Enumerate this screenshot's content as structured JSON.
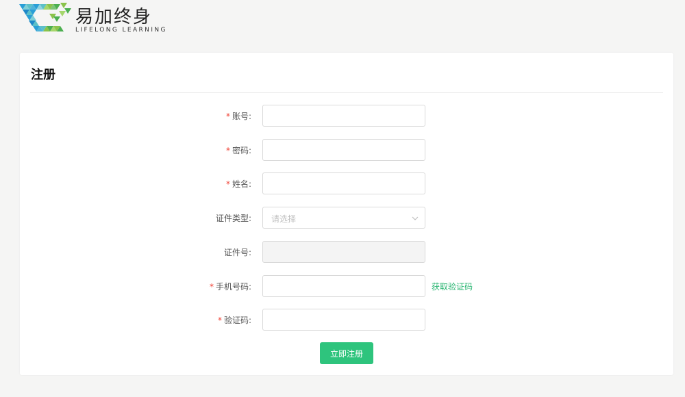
{
  "brand": {
    "name_cn": "易加终身",
    "name_en": "LIFELONG  LEARNING",
    "logo_colors": [
      "#2a9fd6",
      "#5cc0c8",
      "#8bc34a",
      "#4caf50",
      "#1e88c8"
    ]
  },
  "page": {
    "title": "注册"
  },
  "form": {
    "required_mark": "*",
    "fields": {
      "account": {
        "label": "账号:",
        "required": true,
        "value": ""
      },
      "password": {
        "label": "密码:",
        "required": true,
        "value": ""
      },
      "name": {
        "label": "姓名:",
        "required": true,
        "value": ""
      },
      "id_type": {
        "label": "证件类型:",
        "required": false,
        "placeholder": "请选择",
        "icon": "chevron-down-icon"
      },
      "id_number": {
        "label": "证件号:",
        "required": false,
        "value": "",
        "disabled": true
      },
      "phone": {
        "label": "手机号码:",
        "required": true,
        "value": ""
      },
      "code": {
        "label": "验证码:",
        "required": true,
        "value": ""
      }
    },
    "get_code_label": "获取验证码",
    "submit_label": "立即注册"
  },
  "colors": {
    "accent": "#2ec47d",
    "link": "#2bb673",
    "required": "#f04134"
  }
}
